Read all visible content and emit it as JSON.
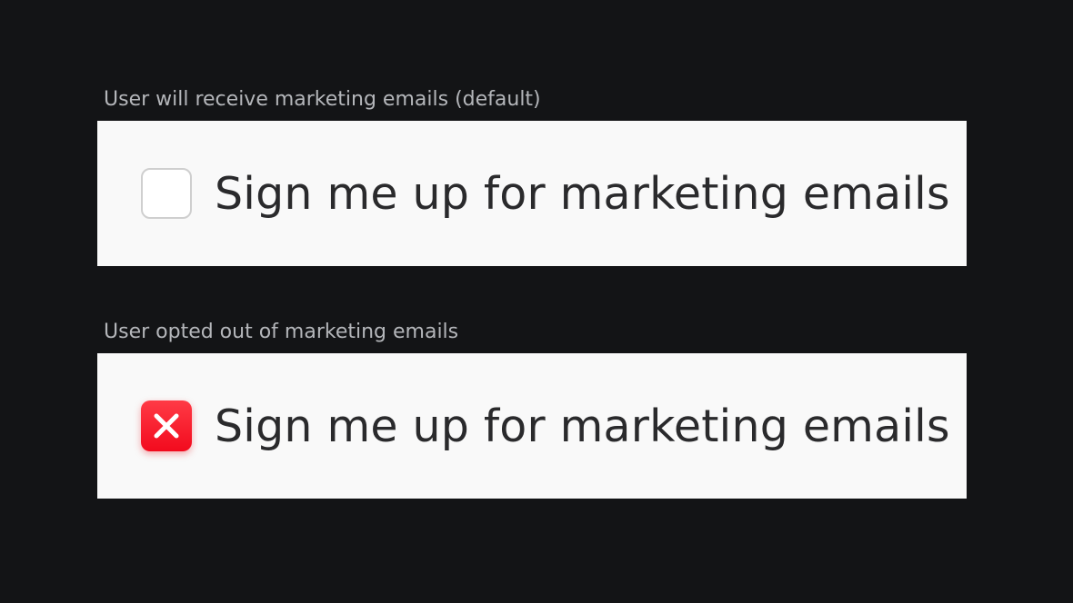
{
  "examples": [
    {
      "caption": "User will receive marketing emails (default)",
      "checkbox_state": "unchecked",
      "checkbox_icon": "none",
      "option_label": "Sign me up for marketing emails"
    },
    {
      "caption": "User opted out of marketing emails",
      "checkbox_state": "opted-out",
      "checkbox_icon": "x-mark-icon",
      "option_label": "Sign me up for marketing emails"
    }
  ],
  "colors": {
    "background": "#131416",
    "panel": "#f9f9f9",
    "caption_text": "#b4b6ba",
    "label_text": "#2a2a2c",
    "optout_red": "#f20a1d",
    "unchecked_border": "#cfcfcf"
  }
}
